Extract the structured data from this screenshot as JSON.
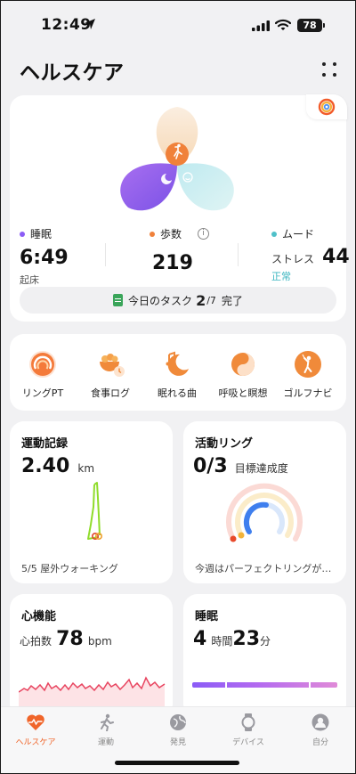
{
  "status": {
    "time": "12:49",
    "battery": "78"
  },
  "header": {
    "title": "ヘルスケア"
  },
  "summary": {
    "sleep": {
      "label": "睡眠",
      "value": "6:49",
      "sub": "起床",
      "color": "#8b5cf6"
    },
    "steps": {
      "label": "歩数",
      "value": "219",
      "color": "#f0813a"
    },
    "mood": {
      "label": "ムード",
      "stress_label": "ストレス",
      "stress_value": "44",
      "status": "正常",
      "color": "#4fc0c9"
    },
    "task": {
      "prefix": "今日のタスク",
      "done": "2",
      "total": "/7",
      "suffix": "完了"
    }
  },
  "shortcuts": [
    {
      "label": "リングPT",
      "icon": "ring-icon"
    },
    {
      "label": "食事ログ",
      "icon": "meal-log-icon"
    },
    {
      "label": "眠れる曲",
      "icon": "sleep-music-icon"
    },
    {
      "label": "呼吸と瞑想",
      "icon": "breathing-icon"
    },
    {
      "label": "ゴルフナビ",
      "icon": "golf-icon"
    }
  ],
  "exercise": {
    "title": "運動記録",
    "value": "2.40",
    "unit": "km",
    "footer": "5/5 屋外ウォーキング"
  },
  "activity": {
    "title": "活動リング",
    "value": "0/3",
    "unit": "目標達成度",
    "footer": "今週はパーフェクトリングが…"
  },
  "heart": {
    "title": "心機能",
    "prefix": "心拍数",
    "value": "78",
    "unit": "bpm"
  },
  "sleep_card": {
    "title": "睡眠",
    "hours": "4",
    "hours_unit": "時間",
    "minutes": "23",
    "minutes_unit": "分"
  },
  "tabs": [
    {
      "label": "ヘルスケア",
      "icon": "heart-pulse-icon",
      "active": true
    },
    {
      "label": "運動",
      "icon": "running-icon",
      "active": false
    },
    {
      "label": "発見",
      "icon": "discover-icon",
      "active": false
    },
    {
      "label": "デバイス",
      "icon": "watch-icon",
      "active": false
    },
    {
      "label": "自分",
      "icon": "profile-icon",
      "active": false
    }
  ],
  "colors": {
    "accent": "#f0652a",
    "sleep": "#8b5cf6",
    "steps": "#f0813a",
    "mood": "#4fc0c9"
  }
}
